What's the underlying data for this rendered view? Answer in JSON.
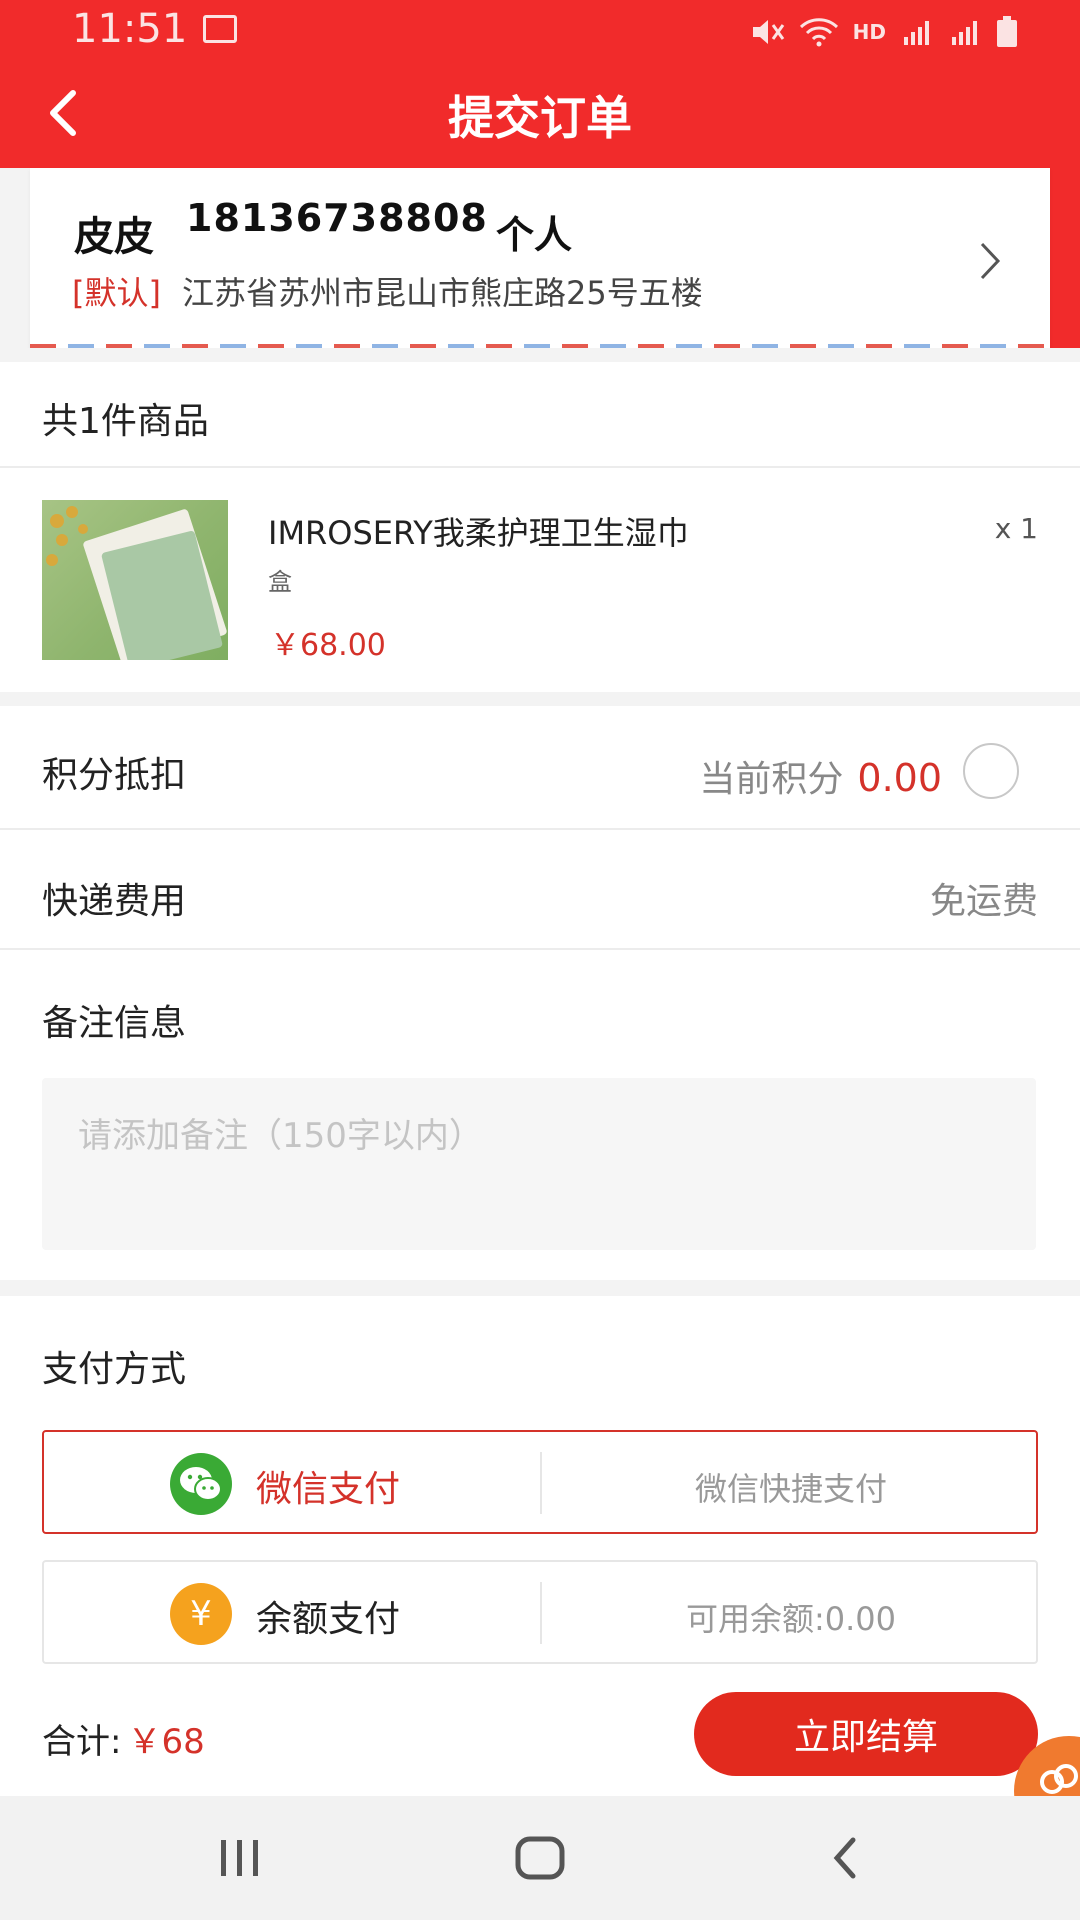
{
  "status_bar": {
    "time": "11:51",
    "network_label": "HD"
  },
  "header": {
    "title": "提交订单"
  },
  "address": {
    "name": "皮皮",
    "phone": "18136738808",
    "tag": "个人",
    "default_label": "[默认]",
    "detail": "江苏省苏州市昆山市熊庄路25号五楼"
  },
  "goods": {
    "count_label": "共1件商品",
    "items": [
      {
        "name": "IMROSERY我柔护理卫生湿巾",
        "unit": "盒",
        "price": "￥68.00",
        "qty": "x 1"
      }
    ]
  },
  "points": {
    "label": "积分抵扣",
    "current_label": "当前积分",
    "value": "0.00",
    "enabled": false
  },
  "shipping": {
    "label": "快递费用",
    "value": "免运费"
  },
  "remark": {
    "label": "备注信息",
    "placeholder": "请添加备注（150字以内）"
  },
  "payment": {
    "label": "支付方式",
    "options": [
      {
        "name": "微信支付",
        "desc": "微信快捷支付",
        "icon": "wechat-icon",
        "color": "#3aaa35",
        "selected": true
      },
      {
        "name": "余额支付",
        "desc": "可用余额:0.00",
        "icon": "yuan-icon",
        "color": "#f5a21e",
        "selected": false
      }
    ]
  },
  "footer": {
    "total_label": "合计:",
    "total_value": "￥68",
    "checkout_label": "立即结算"
  },
  "colors": {
    "brand_red": "#f12b2b",
    "price_red": "#d4322a",
    "button_red": "#e22a1e"
  }
}
